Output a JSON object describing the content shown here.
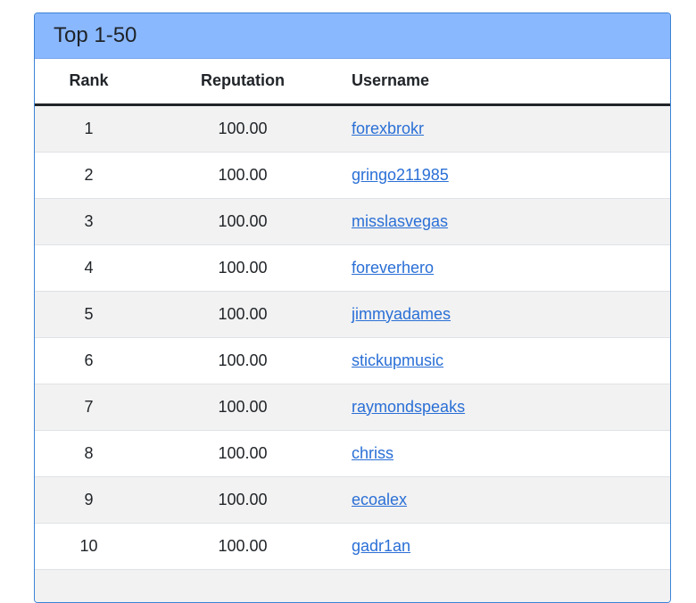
{
  "panel": {
    "title": "Top 1-50"
  },
  "table": {
    "headers": {
      "rank": "Rank",
      "reputation": "Reputation",
      "username": "Username"
    },
    "rows": [
      {
        "rank": "1",
        "reputation": "100.00",
        "username": "forexbrokr"
      },
      {
        "rank": "2",
        "reputation": "100.00",
        "username": "gringo211985"
      },
      {
        "rank": "3",
        "reputation": "100.00",
        "username": "misslasvegas"
      },
      {
        "rank": "4",
        "reputation": "100.00",
        "username": "foreverhero"
      },
      {
        "rank": "5",
        "reputation": "100.00",
        "username": "jimmyadames"
      },
      {
        "rank": "6",
        "reputation": "100.00",
        "username": "stickupmusic"
      },
      {
        "rank": "7",
        "reputation": "100.00",
        "username": "raymondspeaks"
      },
      {
        "rank": "8",
        "reputation": "100.00",
        "username": "chriss"
      },
      {
        "rank": "9",
        "reputation": "100.00",
        "username": "ecoalex"
      },
      {
        "rank": "10",
        "reputation": "100.00",
        "username": "gadr1an"
      }
    ]
  },
  "colors": {
    "heading_bg": "#8ab8ff",
    "border": "#3b82d6",
    "link": "#2a6fd6",
    "stripe": "#f2f2f2"
  }
}
